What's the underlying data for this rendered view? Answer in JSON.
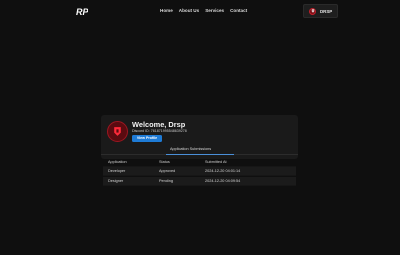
{
  "nav": {
    "logo_text": "RP",
    "links": [
      "Home",
      "About Us",
      "Services",
      "Contact"
    ]
  },
  "user": {
    "name": "DRSP"
  },
  "profile": {
    "welcome": "Welcome, Drsp",
    "discord_id": "Discord ID: 761871995548639278",
    "view_profile_label": "View Profile"
  },
  "tabs": {
    "active": "Application Submissions"
  },
  "table": {
    "headers": [
      "Application",
      "Status",
      "Submitted At"
    ],
    "rows": [
      [
        "Developer",
        "Approved",
        "2024-12-20 04:01:14"
      ],
      [
        "Designer",
        "Pending",
        "2024-12-20 04:09:54"
      ]
    ]
  },
  "colors": {
    "accent": "#1e7bd6",
    "brand_red": "#c21e2a",
    "background": "#0f0f0f",
    "card": "#1a1a1a"
  },
  "icons": {
    "logo": "rp-logo-icon",
    "avatar": "discord-avatar-icon"
  }
}
